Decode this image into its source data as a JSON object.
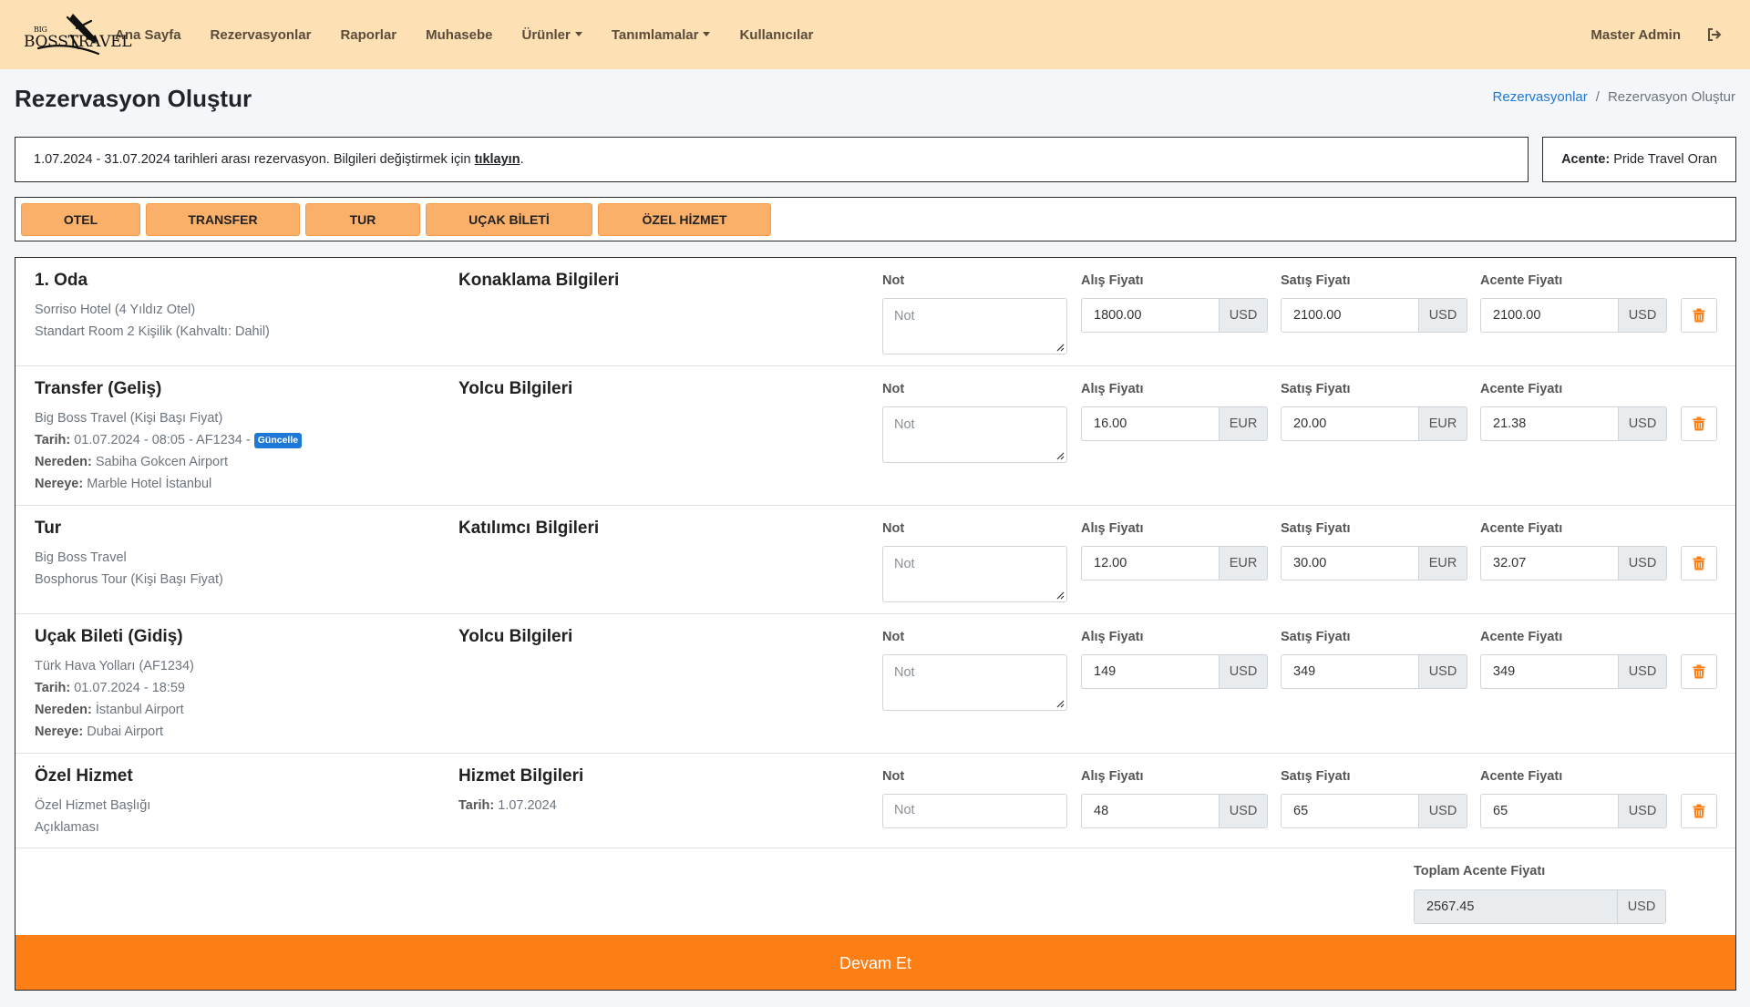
{
  "brand": {
    "line1": "BIG",
    "line2": "BOSSTRAVEL"
  },
  "nav": {
    "items": [
      {
        "label": "Ana Sayfa",
        "dropdown": false
      },
      {
        "label": "Rezervasyonlar",
        "dropdown": false
      },
      {
        "label": "Raporlar",
        "dropdown": false
      },
      {
        "label": "Muhasebe",
        "dropdown": false
      },
      {
        "label": "Ürünler",
        "dropdown": true
      },
      {
        "label": "Tanımlamalar",
        "dropdown": true
      },
      {
        "label": "Kullanıcılar",
        "dropdown": false
      }
    ],
    "user": "Master Admin",
    "logout_icon": "logout-icon"
  },
  "header": {
    "title": "Rezervasyon Oluştur",
    "breadcrumb": [
      "Rezervasyonlar",
      "/",
      "Rezervasyon Oluştur"
    ]
  },
  "info": {
    "text": "1.07.2024 - 31.07.2024 tarihleri arası rezervasyon. Bilgileri değiştirmek için",
    "link": "tıklayın",
    "suffix": "."
  },
  "agency": {
    "label": "Acente:",
    "value": "Pride Travel Oran"
  },
  "services": [
    "OTEL",
    "TRANSFER",
    "TUR",
    "UÇAK BİLETİ",
    "ÖZEL HİZMET"
  ],
  "labels": {
    "note": "Not",
    "buy": "Alış Fiyatı",
    "sell": "Satış Fiyatı",
    "agency": "Acente Fiyatı",
    "note_placeholder": "Not"
  },
  "items": [
    {
      "title": "1. Oda",
      "lines": [
        {
          "label": "",
          "value": "Sorriso Hotel (4 Yıldız Otel)"
        },
        {
          "label": "",
          "value": "Standart Room 2 Kişilik (Kahvaltı: Dahil)"
        }
      ],
      "info_title": "Konaklama Bilgileri",
      "info_line": {
        "label": "",
        "value": ""
      },
      "buy": {
        "value": "1800.00",
        "currency": "USD"
      },
      "sell": {
        "value": "2100.00",
        "currency": "USD"
      },
      "agency": {
        "value": "2100.00",
        "currency": "USD"
      }
    },
    {
      "title": "Transfer (Geliş)",
      "lines": [
        {
          "label": "",
          "value": "Big Boss Travel (Kişi Başı Fiyat)"
        },
        {
          "label": "Tarih:",
          "value": "01.07.2024 - 08:05 - AF1234 -",
          "badge": "Güncelle"
        },
        {
          "label": "Nereden:",
          "value": "Sabiha Gokcen Airport"
        },
        {
          "label": "Nereye:",
          "value": "Marble Hotel İstanbul"
        }
      ],
      "info_title": "Yolcu Bilgileri",
      "info_line": {
        "label": "",
        "value": ""
      },
      "buy": {
        "value": "16.00",
        "currency": "EUR"
      },
      "sell": {
        "value": "20.00",
        "currency": "EUR"
      },
      "agency": {
        "value": "21.38",
        "currency": "USD"
      }
    },
    {
      "title": "Tur",
      "lines": [
        {
          "label": "",
          "value": "Big Boss Travel"
        },
        {
          "label": "",
          "value": "Bosphorus Tour (Kişi Başı Fiyat)"
        }
      ],
      "info_title": "Katılımcı Bilgileri",
      "info_line": {
        "label": "",
        "value": ""
      },
      "buy": {
        "value": "12.00",
        "currency": "EUR"
      },
      "sell": {
        "value": "30.00",
        "currency": "EUR"
      },
      "agency": {
        "value": "32.07",
        "currency": "USD"
      }
    },
    {
      "title": "Uçak Bileti (Gidiş)",
      "lines": [
        {
          "label": "",
          "value": "Türk Hava Yolları (AF1234)"
        },
        {
          "label": "Tarih:",
          "value": "01.07.2024 - 18:59"
        },
        {
          "label": "Nereden:",
          "value": "İstanbul Airport"
        },
        {
          "label": "Nereye:",
          "value": "Dubai Airport"
        }
      ],
      "info_title": "Yolcu Bilgileri",
      "info_line": {
        "label": "",
        "value": ""
      },
      "buy": {
        "value": "149",
        "currency": "USD"
      },
      "sell": {
        "value": "349",
        "currency": "USD"
      },
      "agency": {
        "value": "349",
        "currency": "USD"
      }
    },
    {
      "title": "Özel Hizmet",
      "lines": [
        {
          "label": "",
          "value": "Özel Hizmet Başlığı"
        },
        {
          "label": "",
          "value": "Açıklaması"
        }
      ],
      "info_title": "Hizmet Bilgileri",
      "info_line": {
        "label": "Tarih:",
        "value": "1.07.2024"
      },
      "buy": {
        "value": "48",
        "currency": "USD"
      },
      "sell": {
        "value": "65",
        "currency": "USD"
      },
      "agency": {
        "value": "65",
        "currency": "USD"
      }
    }
  ],
  "total": {
    "label": "Toplam Acente Fiyatı",
    "value": "2567.45",
    "currency": "USD"
  },
  "continue_label": "Devam Et",
  "colors": {
    "navbar": "#fde0b4",
    "service_button": "#fbb06a",
    "primary": "#fd7e14",
    "link": "#1e78d8",
    "trash": "#fd7e14"
  }
}
